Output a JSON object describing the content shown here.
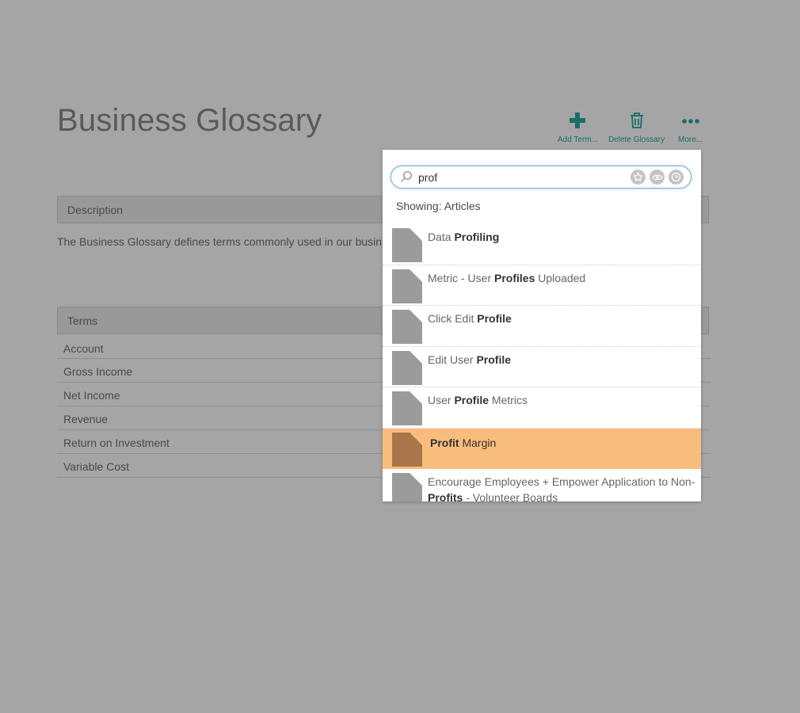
{
  "page": {
    "title": "Business Glossary"
  },
  "toolbar": {
    "add_label": "Add Term...",
    "delete_label": "Delete Glossary",
    "more_label": "More..."
  },
  "description": {
    "header": "Description",
    "text": "The Business Glossary defines terms commonly used in our busin"
  },
  "terms": {
    "header": "Terms",
    "items": [
      "Account",
      "Gross Income",
      "Net Income",
      "Revenue",
      "Return on Investment",
      "Variable Cost"
    ]
  },
  "search": {
    "query": "prof",
    "showing": "Showing: Articles",
    "results": [
      {
        "pre": "Data ",
        "match": "Profiling",
        "post": ""
      },
      {
        "pre": "Metric - User ",
        "match": "Profiles",
        "post": " Uploaded"
      },
      {
        "pre": "Click Edit ",
        "match": "Profile",
        "post": ""
      },
      {
        "pre": "Edit User ",
        "match": "Profile",
        "post": ""
      },
      {
        "pre": "User ",
        "match": "Profile",
        "post": " Metrics"
      },
      {
        "pre": "",
        "match": "Profit",
        "post": " Margin"
      },
      {
        "pre": "Encourage Employees + Empower Application to Non-",
        "match": "Profits",
        "post": " - Volunteer Boards"
      }
    ],
    "active_index": 5
  },
  "colors": {
    "accent": "#1a6e66",
    "highlight": "#f8bd7c",
    "overlay": "#a5a5a5"
  }
}
